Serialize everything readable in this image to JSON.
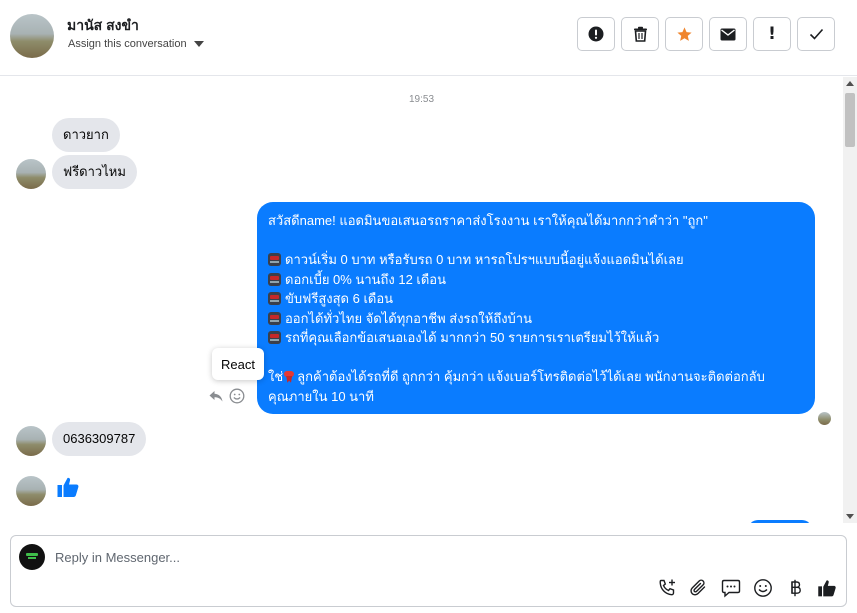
{
  "header": {
    "contact_name": "มานัส สงขำ",
    "assign_label": "Assign this conversation",
    "actions": [
      {
        "name": "alert-circle-icon"
      },
      {
        "name": "trash-icon"
      },
      {
        "name": "star-icon",
        "color": "#f0852d"
      },
      {
        "name": "envelope-icon"
      },
      {
        "name": "exclamation-icon",
        "glyph": "!"
      },
      {
        "name": "checkmark-icon"
      }
    ]
  },
  "conversation": {
    "timestamp": "19:53",
    "incoming_1": "ดาวยาก",
    "incoming_2": "ฟรีดาวไหม",
    "outgoing": {
      "line1": "สวัสดีname! แอดมินขอเสนอรถราคาส่งโรงงาน เราให้คุณได้มากกว่าคำว่า \"ถูก\"",
      "bullets": [
        "ดาวน์เริ่ม 0 บาท หรือรับรถ 0 บาท หารถโปรฯแบบนี้อยู่แจ้งแอดมินได้เลย",
        "ดอกเบี้ย 0% นานถึง 12 เดือน",
        "ขับฟรีสูงสุด 6 เดือน",
        "ออกได้ทั่วไทย จัดได้ทุกอาชีพ ส่งรถให้ถึงบ้าน",
        "รถที่คุณเลือกข้อเสนอเองได้ มากกว่า 50 รายการเราเตรียมไว้ให้แล้ว"
      ],
      "closing_prefix": "ใช่",
      "closing_line1": "ลูกค้าต้องได้รถที่ดี ถูกกว่า คุ้มกว่า แจ้งเบอร์โทรติดต่อไว้ได้เลย พนักงานจะติดต่อกลับ",
      "closing_line2": "คุณภายใน 10 นาที"
    },
    "tooltip": "React",
    "incoming_3": "0636309787",
    "incoming_4_icon": "thumbs-up-icon"
  },
  "composer": {
    "placeholder": "Reply in Messenger...",
    "tools": [
      "phone-plus-icon",
      "paperclip-icon",
      "chat-bubble-icon",
      "emoji-icon",
      "baht-icon",
      "thumbs-up-icon"
    ]
  },
  "colors": {
    "accent": "#0a7cff",
    "incoming_bubble": "#e4e6eb",
    "star": "#f0852d",
    "like": "#0a7cff"
  }
}
